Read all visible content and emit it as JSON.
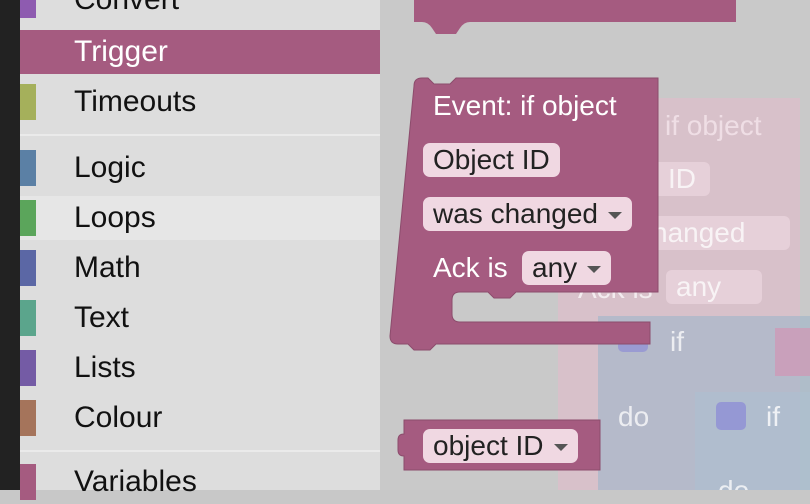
{
  "toolbox": {
    "categories": [
      {
        "label": "Convert",
        "color": "#8e5bb0"
      },
      {
        "label": "Trigger",
        "color": "#a55b80"
      },
      {
        "label": "Timeouts",
        "color": "#a5b05b"
      },
      {
        "label": "Logic",
        "color": "#5b80a5"
      },
      {
        "label": "Loops",
        "color": "#5ba55b"
      },
      {
        "label": "Math",
        "color": "#5b67a5"
      },
      {
        "label": "Text",
        "color": "#5ba58c"
      },
      {
        "label": "Lists",
        "color": "#745ba5"
      },
      {
        "label": "Colour",
        "color": "#a5745b"
      },
      {
        "label": "Variables",
        "color": "#a55b80"
      }
    ],
    "selected": "Trigger"
  },
  "workspace": {
    "event_block": {
      "title": "Event: if object",
      "object_id_label": "Object ID",
      "condition_value": "was changed",
      "ack_label": "Ack is",
      "ack_value": "any",
      "color": "#a55b80"
    },
    "object_id_block": {
      "value": "object ID"
    },
    "background_blocks": {
      "if_object": "if object",
      "id_fragment": "ID",
      "changed_fragment": "nanged",
      "ack_fragment": "Ack is",
      "any_value": "any",
      "if_label_1": "if",
      "do_label": "do",
      "if_label_2": "if",
      "do_label_2": "do"
    }
  }
}
